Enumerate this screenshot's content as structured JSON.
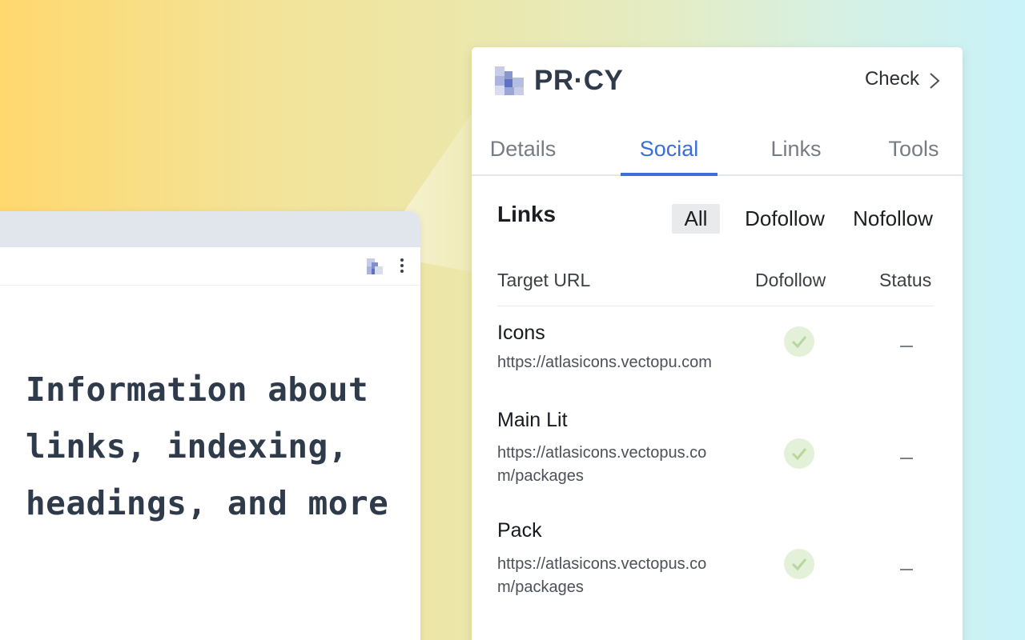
{
  "browser": {
    "hero_text": "Information about links, indexing, headings, and more"
  },
  "popup": {
    "logo_text": "PR·CY",
    "check_label": "Check",
    "tabs": [
      {
        "label": "Details",
        "active": false
      },
      {
        "label": "Social",
        "active": true
      },
      {
        "label": "Links",
        "active": false
      },
      {
        "label": "Tools",
        "active": false
      }
    ],
    "section_title": "Links",
    "filters": [
      {
        "label": "All",
        "active": true
      },
      {
        "label": "Dofollow",
        "active": false
      },
      {
        "label": "Nofollow",
        "active": false
      }
    ],
    "columns": [
      "Target URL",
      "Dofollow",
      "Status"
    ],
    "rows": [
      {
        "title": "Icons",
        "url": "https://atlasicons.vectopu.com",
        "dofollow": true,
        "status": "–"
      },
      {
        "title": "Main Lit",
        "url": "https://atlasicons.vectopus.com/packages",
        "dofollow": true,
        "status": "–"
      },
      {
        "title": "Pack",
        "url": "https://atlasicons.vectopus.com/packages",
        "dofollow": true,
        "status": "–"
      }
    ]
  },
  "colors": {
    "accent": "#3a6edb",
    "text_dark": "#2f3b4a",
    "check_bg": "#e3f1d8",
    "check_mark": "#b7d6a0"
  }
}
